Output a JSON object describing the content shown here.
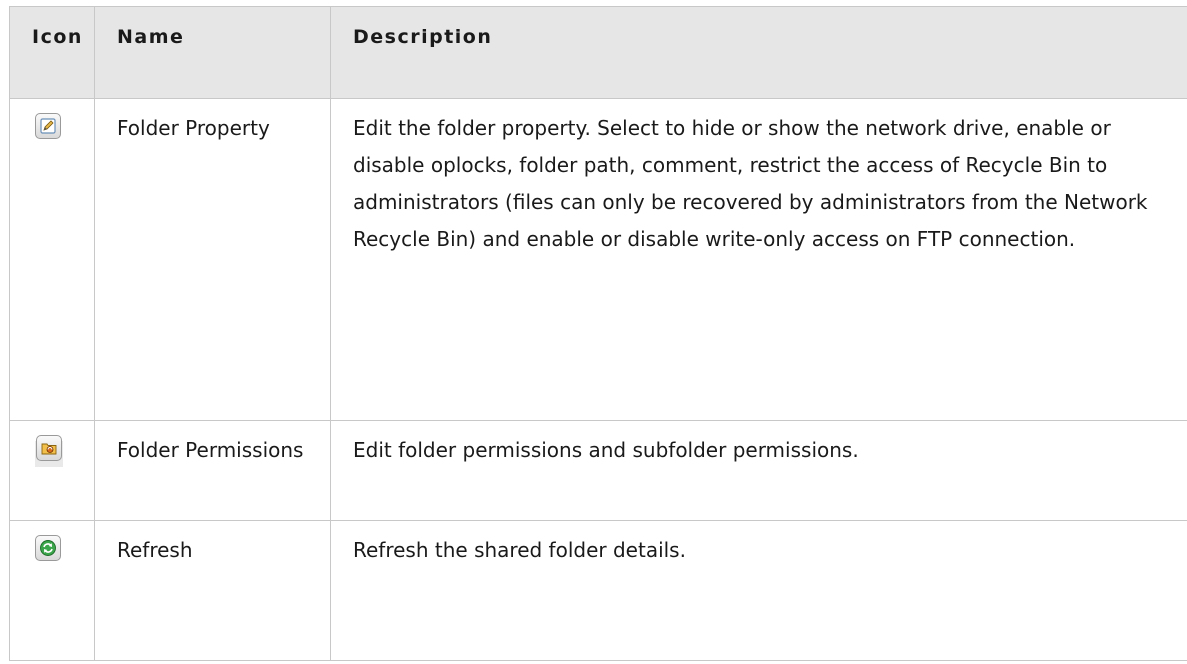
{
  "table": {
    "headers": {
      "icon": "Icon",
      "name": "Name",
      "description": "Description"
    },
    "rows": [
      {
        "icon": "edit-pencil-icon",
        "name": "Folder Property",
        "description": "Edit the folder property. Select to hide or show the network drive, enable or disable oplocks, folder path, comment, restrict the access of Recycle Bin to administrators (files can only be recovered by administrators from the Network Recycle Bin) and enable or disable write-only access on FTP connection."
      },
      {
        "icon": "folder-permissions-icon",
        "name": "Folder Permissions",
        "description": "Edit folder permissions and subfolder permissions."
      },
      {
        "icon": "refresh-icon",
        "name": "Refresh",
        "description": "Refresh the shared folder details."
      }
    ]
  }
}
